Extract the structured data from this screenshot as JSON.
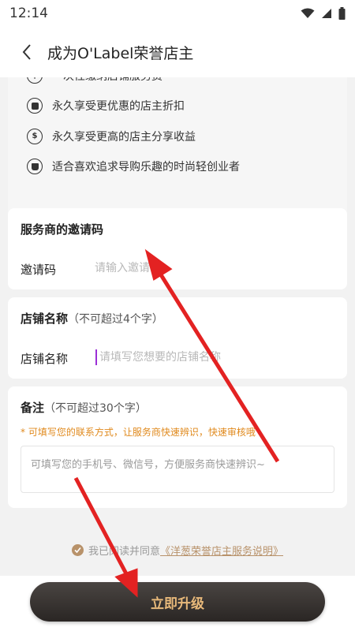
{
  "status_bar": {
    "time": "12:14",
    "icons": [
      "wifi-icon",
      "signal-icon",
      "battery-icon"
    ]
  },
  "header": {
    "title": "成为O'Label荣誉店主",
    "back_icon": "chevron-left-icon"
  },
  "benefits": [
    {
      "icon": "plus-circle-icon",
      "text": "一次性缴纳店铺服务费"
    },
    {
      "icon": "tag-icon",
      "text": "永久享受更优惠的店主折扣"
    },
    {
      "icon": "money-bag-icon",
      "text": "永久享受更高的店主分享收益"
    },
    {
      "icon": "shop-icon",
      "text": "适合喜欢追求导购乐趣的时尚轻创业者"
    }
  ],
  "invite_card": {
    "title": "服务商的邀请码",
    "label": "邀请码",
    "placeholder": "请输入邀请码"
  },
  "store_card": {
    "title": "店铺名称",
    "title_note": "（不可超过4个字）",
    "label": "店铺名称",
    "placeholder": "请填写您想要的店铺名称"
  },
  "remark_card": {
    "title": "备注",
    "title_note": "（不可超过30个字）",
    "hint": "* 可填写您的联系方式，让服务商快速辨识，快速审核哦",
    "placeholder": "可填写您的手机号、微信号，方便服务商快速辨识~"
  },
  "agreement": {
    "prefix": "我已阅读并同意",
    "link": "《洋葱荣誉店主服务说明》"
  },
  "upgrade_button": "立即升级",
  "colors": {
    "accent_gold": "#b8926a",
    "hint_orange": "#e08a1e",
    "button_dark": "#2a2624",
    "button_text": "#e8b97a",
    "annotation_arrow": "#e32222"
  }
}
